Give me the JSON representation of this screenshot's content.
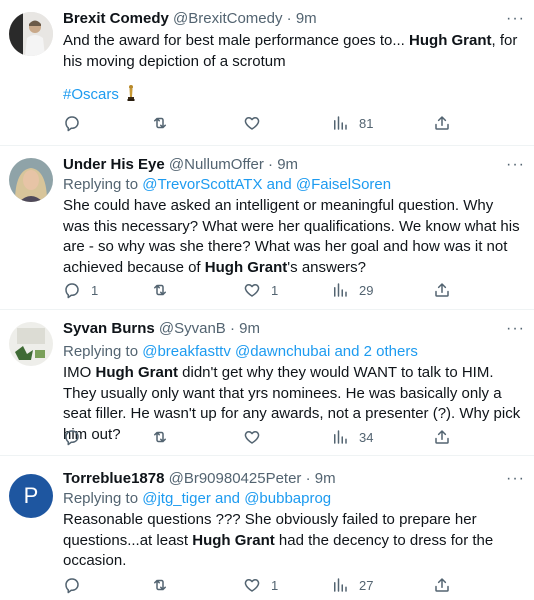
{
  "tweets": [
    {
      "name": "Brexit Comedy",
      "handle": "@BrexitComedy",
      "sep": "·",
      "time": "9m",
      "text_pre": "And the award for best male performance goes to... ",
      "text_bold": "Hugh Grant",
      "text_post": ", for his moving depiction of a scrotum",
      "hashtag": "#Oscars",
      "reply_count": "",
      "retweet_count": "",
      "like_count": "",
      "view_count": "81"
    },
    {
      "name": "Under His Eye",
      "handle": "@NullumOffer",
      "sep": "·",
      "time": "9m",
      "replying_label": "Replying to",
      "replying_1": "@TrevorScottATX",
      "replying_and": "and",
      "replying_2": "@FaiselSoren",
      "text_pre": "She could have asked an intelligent or meaningful question.  Why was this necessary? What were her qualifications. We know what his are - so why was she there? What was her goal and how was it not achieved because of ",
      "text_bold": "Hugh Grant",
      "text_post": "'s answers?",
      "reply_count": "1",
      "retweet_count": "",
      "like_count": "1",
      "view_count": "29"
    },
    {
      "name": "Syvan Burns",
      "handle": "@SyvanB",
      "sep": "·",
      "time": "9m",
      "replying_label": "Replying to",
      "replying_1": "@breakfasttv",
      "replying_2": "@dawnchubai",
      "replying_and": "and",
      "replying_3": "2 others",
      "text_pre": "IMO ",
      "text_bold": "Hugh Grant",
      "text_post": " didn't get why they would WANT to talk to HIM. They usually only want that yrs nominees. He was basically only a seat filler. He wasn't up for any awards, not a presenter (?). Why pick him out?",
      "reply_count": "",
      "retweet_count": "",
      "like_count": "",
      "view_count": "34"
    },
    {
      "name": "Torreblue1878",
      "handle": "@Br90980425Peter",
      "sep": "·",
      "time": "9m",
      "avatar_letter": "P",
      "replying_label": "Replying to",
      "replying_1": "@jtg_tiger",
      "replying_and": "and",
      "replying_2": "@bubbaprog",
      "text_pre": "Reasonable questions ??? She obviously failed to prepare her questions...at least ",
      "text_bold": "Hugh Grant",
      "text_post": " had the decency to dress for the occasion.",
      "reply_count": "",
      "retweet_count": "",
      "like_count": "1",
      "view_count": "27"
    }
  ],
  "more_glyph": "···",
  "colors": {
    "link": "#1d9bf0",
    "muted": "#536471",
    "text": "#0f1419",
    "avatar_p": "#1e56a0"
  },
  "icons": [
    "reply-icon",
    "retweet-icon",
    "like-icon",
    "views-icon",
    "share-icon",
    "oscar-trophy-icon",
    "more-icon"
  ]
}
